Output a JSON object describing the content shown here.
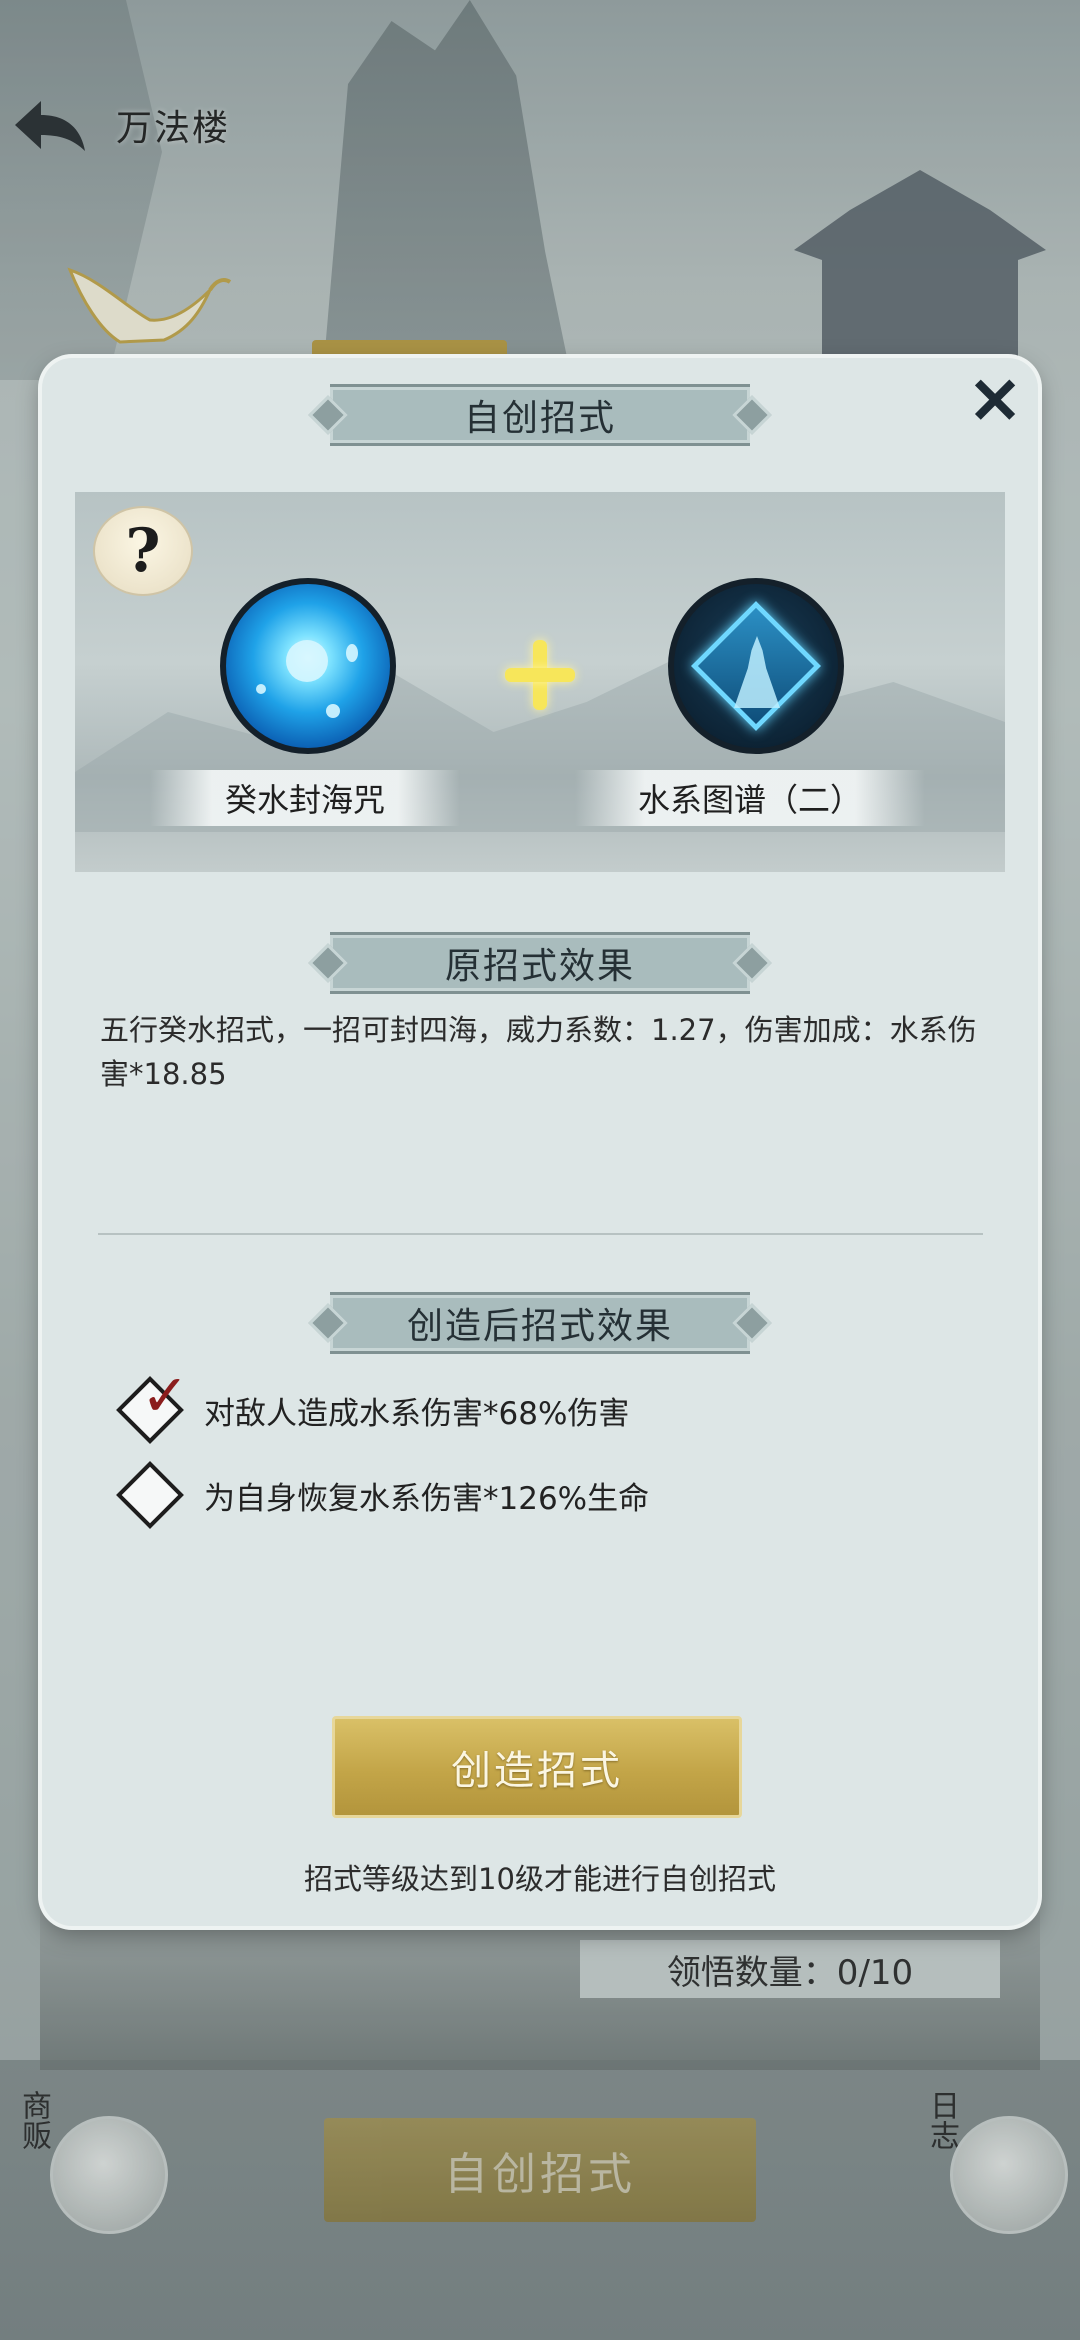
{
  "header": {
    "back_icon": "back-arrow-icon",
    "title": "万法楼"
  },
  "modal": {
    "title": "自创招式",
    "close_icon": "close-icon",
    "help_icon": "question-mark-icon",
    "help_label": "?",
    "ingredients": [
      {
        "name": "癸水封海咒",
        "icon": "water-spell-orb-icon"
      },
      {
        "name": "水系图谱（二）",
        "icon": "water-diagram-icon"
      }
    ],
    "plus_icon": "plus-icon",
    "original_effect": {
      "title": "原招式效果",
      "text": "五行癸水招式，一招可封四海，威力系数：1.27，伤害加成：水系伤害*18.85"
    },
    "created_effect": {
      "title": "创造后招式效果",
      "options": [
        {
          "label": "对敌人造成水系伤害*68%伤害",
          "checked": true
        },
        {
          "label": "为自身恢复水系伤害*126%生命",
          "checked": false
        }
      ]
    },
    "create_button": "创造招式",
    "hint": "招式等级达到10级才能进行自创招式"
  },
  "background": {
    "comprehend_count": "领悟数量：0/10",
    "bottom_create_button": "自创招式",
    "merchant_label": "商贩",
    "log_label": "日志"
  },
  "colors": {
    "gold_button": "#c3a548",
    "panel_bg": "#dde6e6",
    "banner_bg": "#a9bcbd",
    "check_red": "#8b1d1d"
  }
}
